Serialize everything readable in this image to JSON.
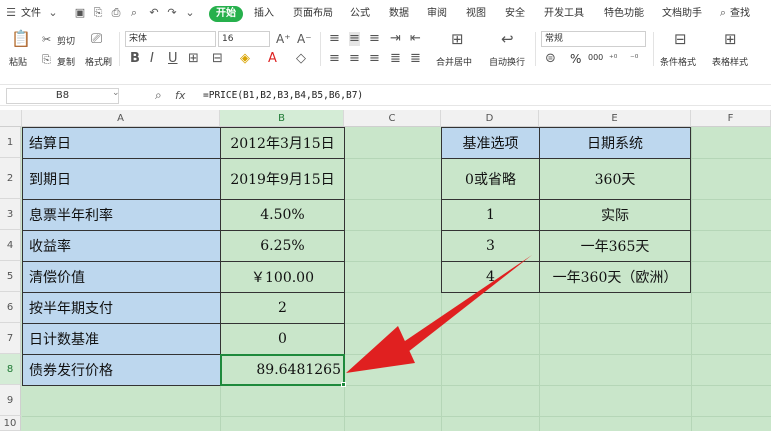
{
  "menu": {
    "file": "文件",
    "tabs": [
      "开始",
      "插入",
      "页面布局",
      "公式",
      "数据",
      "审阅",
      "视图",
      "安全",
      "开发工具",
      "特色功能",
      "文档助手"
    ],
    "search": "查找"
  },
  "ribbon": {
    "paste": "粘贴",
    "cut": "剪切",
    "copy": "复制",
    "format_painter": "格式刷",
    "font_name": "宋体",
    "font_size": "16",
    "merge_center": "合并居中",
    "wrap_text": "自动换行",
    "number_format": "常规",
    "percent": "%",
    "thousands": "000",
    "conditional_format": "条件格式",
    "table_style": "表格样式"
  },
  "formula_bar": {
    "cell_ref": "B8",
    "fx": "fx",
    "formula": "=PRICE(B1,B2,B3,B4,B5,B6,B7)"
  },
  "columns": [
    "A",
    "B",
    "C",
    "D",
    "E",
    "F"
  ],
  "rows": [
    "1",
    "2",
    "3",
    "4",
    "5",
    "6",
    "7",
    "8",
    "9",
    "10"
  ],
  "table": [
    {
      "label": "结算日",
      "value": "2012年3月15日"
    },
    {
      "label": "到期日",
      "value": "2019年9月15日"
    },
    {
      "label": "息票半年利率",
      "value": "4.50%"
    },
    {
      "label": "收益率",
      "value": "6.25%"
    },
    {
      "label": "清偿价值",
      "value": "￥100.00"
    },
    {
      "label": "按半年期支付",
      "value": "2"
    },
    {
      "label": "日计数基准",
      "value": "0"
    },
    {
      "label": "债券发行价格",
      "value": "89.6481265"
    }
  ],
  "ref_table": {
    "headers": [
      "基准选项",
      "日期系统"
    ],
    "rows": [
      [
        "0或省略",
        "360天"
      ],
      [
        "1",
        "实际"
      ],
      [
        "3",
        "一年365天"
      ],
      [
        "4",
        "一年360天（欧洲）"
      ]
    ]
  },
  "colors": {
    "grid_bg": "#c9e6ca",
    "label_bg": "#bdd7ee",
    "accent_green": "#26b04c",
    "arrow": "#e02020"
  }
}
